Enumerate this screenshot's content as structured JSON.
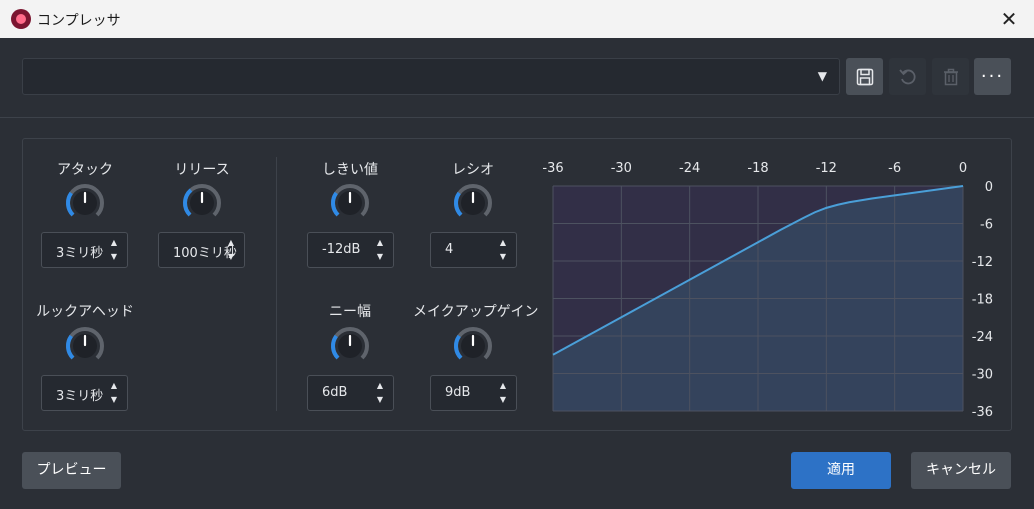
{
  "window": {
    "title": "コンプレッサ",
    "close": "✕"
  },
  "preset": {
    "value": "",
    "dropdown_glyph": "▼",
    "more_label": "···"
  },
  "controls": {
    "attack": {
      "label": "アタック",
      "value": "3ミリ秒",
      "knob_level": 0.3
    },
    "release": {
      "label": "リリース",
      "value": "100ミリ秒",
      "knob_level": 0.35
    },
    "lookahead": {
      "label": "ルックアヘッド",
      "value": "3ミリ秒",
      "knob_level": 0.3
    },
    "threshold": {
      "label": "しきい値",
      "value": "-12dB",
      "knob_level": 0.3
    },
    "ratio": {
      "label": "レシオ",
      "value": "4",
      "knob_level": 0.3
    },
    "knee": {
      "label": "ニー幅",
      "value": "6dB",
      "knob_level": 0.3
    },
    "makeup": {
      "label": "メイクアップゲイン",
      "value": "9dB",
      "knob_level": 0.3
    }
  },
  "spin_glyphs": {
    "up": "▲",
    "down": "▼"
  },
  "chart_data": {
    "type": "line",
    "x_ticks": [
      "-36",
      "-30",
      "-24",
      "-18",
      "-12",
      "-6",
      "0"
    ],
    "y_ticks": [
      "0",
      "-6",
      "-12",
      "-18",
      "-24",
      "-30",
      "-36"
    ],
    "xlim": [
      -36,
      0
    ],
    "ylim": [
      -36,
      0
    ],
    "grid": true,
    "series": [
      {
        "x": [
          -36,
          -30,
          -24,
          -18,
          -16,
          -14,
          -13,
          -12,
          -11,
          -10,
          -9,
          -8,
          -6,
          -4,
          -2,
          0
        ],
        "y": [
          -27,
          -21,
          -15,
          -9,
          -7,
          -5.1,
          -4.2,
          -3.5,
          -3.0,
          -2.6,
          -2.3,
          -2.0,
          -1.5,
          -1.0,
          -0.5,
          0
        ]
      }
    ],
    "colors": {
      "line": "#4a9fd8",
      "fill_below": "#34435c",
      "fill_above": "#322f47",
      "grid": "#4d5260"
    }
  },
  "buttons": {
    "preview": "プレビュー",
    "apply": "適用",
    "cancel": "キャンセル"
  },
  "colors": {
    "accent": "#2d72c6",
    "knob_arc": "#2f8ae6"
  }
}
